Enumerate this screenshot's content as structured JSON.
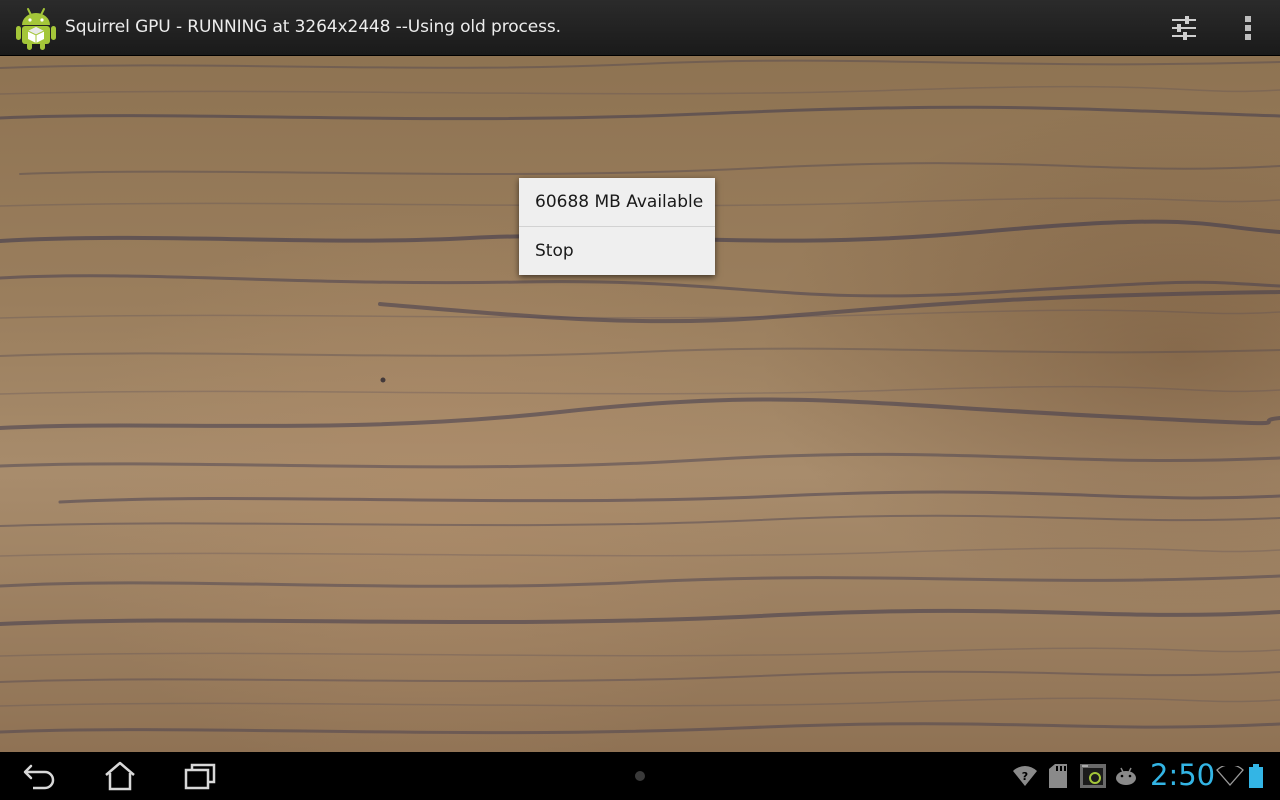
{
  "action_bar": {
    "title": "Squirrel GPU - RUNNING at 3264x2448 --Using old process.",
    "app_icon": "android-robot-icon",
    "settings_icon": "sliders-icon",
    "overflow_icon": "overflow-menu-icon"
  },
  "popup_menu": {
    "items": [
      {
        "label": "60688 MB Available"
      },
      {
        "label": "Stop"
      }
    ]
  },
  "system_bar": {
    "nav": {
      "back_icon": "back-icon",
      "home_icon": "home-icon",
      "recent_icon": "recent-apps-icon"
    },
    "tray_icons": [
      "wifi-question-icon",
      "sd-card-icon",
      "screenshot-icon",
      "android-debug-icon"
    ],
    "clock": "2:50",
    "colors": {
      "clock": "#33b5e5",
      "battery": "#33b5e5"
    }
  }
}
